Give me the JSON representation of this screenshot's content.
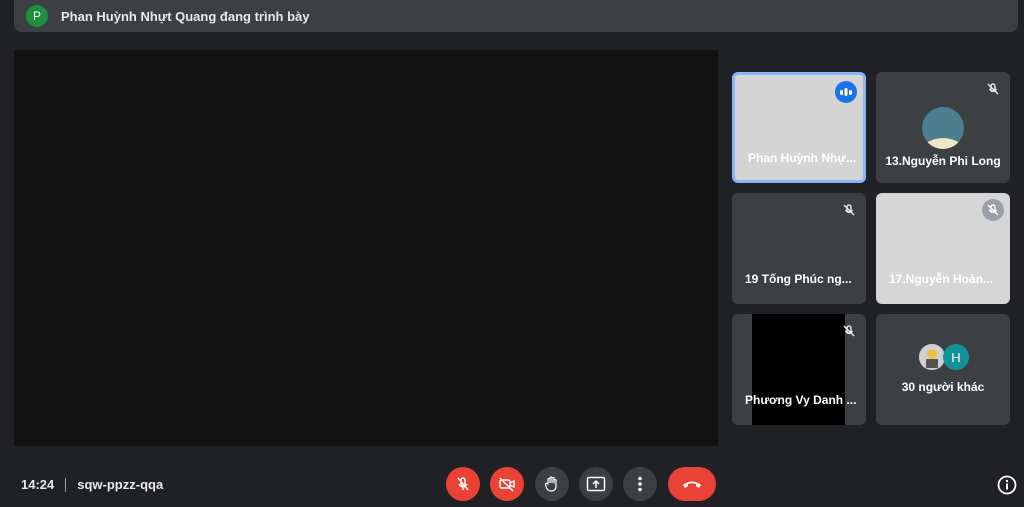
{
  "header": {
    "avatar_letter": "P",
    "presenting_text": "Phan Huỳnh Nhựt Quang đang trình bày"
  },
  "participants": [
    {
      "name": "Phan Huỳnh Nhự...",
      "status": "speaking"
    },
    {
      "name": "13.Nguyễn Phi Long",
      "status": "muted"
    },
    {
      "name": "19 Tống Phúc ng...",
      "status": "muted"
    },
    {
      "name": "17.Nguyễn Hoàn...",
      "status": "muted"
    },
    {
      "name": "Phương Vy Danh ...",
      "status": "muted"
    }
  ],
  "others": {
    "avatar_letter": "H",
    "label": "30 người khác"
  },
  "meeting": {
    "time": "14:24",
    "code": "sqw-ppzz-qqa"
  },
  "colors": {
    "accent_red": "#ea4335",
    "speaking_blue": "#1a73e8",
    "highlight_border": "#8ab4f8"
  }
}
